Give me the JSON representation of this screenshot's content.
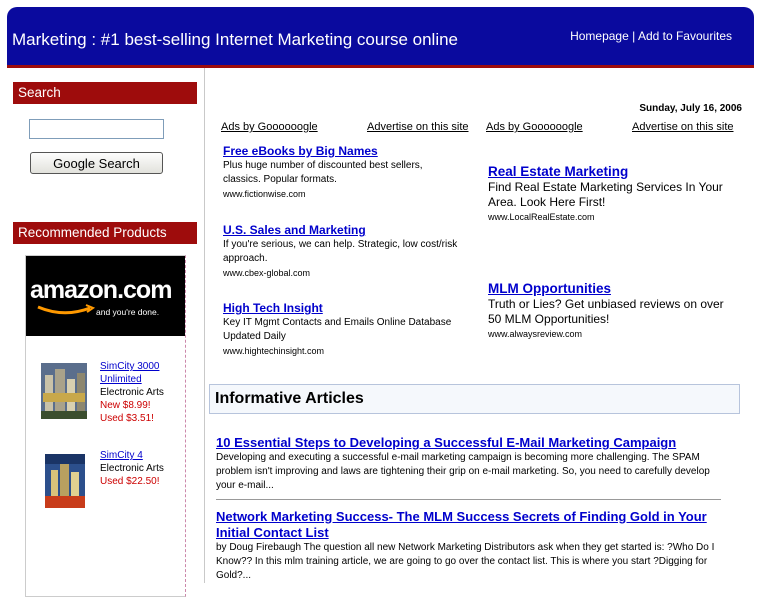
{
  "header": {
    "title": "Marketing : #1 best-selling Internet Marketing course online",
    "homepage": "Homepage",
    "separator": "|",
    "favourites": "Add to Favourites"
  },
  "sidebar": {
    "search_title": "Search",
    "search_button": "Google Search",
    "search_value": "",
    "recommended_title": "Recommended Products",
    "amazon": {
      "brand": "amazon.com",
      "tagline": "and you're done."
    },
    "products": [
      {
        "title": "SimCity 3000 Unlimited",
        "maker": "Electronic Arts",
        "new_price": "New $8.99!",
        "used_price": "Used $3.51!"
      },
      {
        "title": "SimCity 4",
        "maker": "Electronic Arts",
        "used_price": "Used $22.50!"
      }
    ]
  },
  "content": {
    "date": "Sunday, July 16, 2006",
    "ads_by": "Ads by Goooooogle",
    "advertise": "Advertise on this site",
    "left_ads": [
      {
        "title": "Free eBooks by Big Names",
        "desc": "Plus huge number of discounted best sellers, classics. Popular formats.",
        "url": "www.fictionwise.com"
      },
      {
        "title": "U.S. Sales and Marketing",
        "desc": "If you're serious, we can help. Strategic, low cost/risk approach.",
        "url": "www.cbex-global.com"
      },
      {
        "title": "High Tech Insight",
        "desc": "Key IT Mgmt Contacts and Emails Online Database Updated Daily",
        "url": "www.hightechinsight.com"
      }
    ],
    "right_ads": [
      {
        "title": "Real Estate Marketing",
        "desc": "Find Real Estate Marketing Services In Your Area. Look Here First!",
        "url": "www.LocalRealEstate.com"
      },
      {
        "title": "MLM Opportunities",
        "desc": "Truth or Lies? Get unbiased reviews on over 50 MLM Opportunities!",
        "url": "www.alwaysreview.com"
      }
    ],
    "articles_title": "Informative Articles",
    "articles": [
      {
        "title": "10 Essential Steps to Developing a Successful E-Mail Marketing Campaign",
        "desc": "Developing and executing a successful e-mail marketing campaign is becoming more challenging. The SPAM problem isn't improving and laws are tightening their grip on e-mail marketing. So, you need to carefully develop your e-mail..."
      },
      {
        "title": "Network Marketing Success- The MLM Success Secrets of Finding Gold in Your Initial Contact List",
        "desc": "by Doug Firebaugh The question all new Network Marketing Distributors ask when they get started is: ?Who Do I Know?? In this mlm training article, we are going to go over the contact list. This is where you start ?Digging for Gold?..."
      }
    ]
  }
}
